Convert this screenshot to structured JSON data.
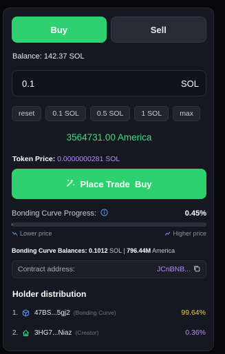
{
  "tabs": {
    "buy_label": "Buy",
    "sell_label": "Sell"
  },
  "balance": {
    "text": "Balance: 142.37 SOL"
  },
  "amount": {
    "value": "0.1",
    "unit": "SOL"
  },
  "presets": [
    "reset",
    "0.1 SOL",
    "0.5 SOL",
    "1 SOL",
    "max"
  ],
  "estimate": {
    "text": "3564731.00 America"
  },
  "token_price": {
    "label": "Token Price:",
    "value": "0.0000000281 SOL"
  },
  "cta": {
    "label": "Place Trade  Buy",
    "icon": "sparkle-icon"
  },
  "bonding": {
    "label": "Bonding Curve Progress:",
    "percent_text": "0.45%",
    "progress": 0.0045,
    "lower_label": "Lower price",
    "higher_label": "Higher price"
  },
  "balances": {
    "label": "Bonding Curve Balances:",
    "sol_value": "0.1012",
    "sol_text": "SOL |",
    "token_value": "796.44M",
    "token_text": "America"
  },
  "contract": {
    "label": "Contract address:",
    "value": "JCnBNB..."
  },
  "holders": {
    "title": "Holder distribution",
    "items": [
      {
        "rank": "1.",
        "address": "47BS...5gj2",
        "tag": "(Bonding Curve)",
        "percent": "99.64%",
        "icon": "cube-icon"
      },
      {
        "rank": "2.",
        "address": "3HG7...Niaz",
        "tag": "(Creator)",
        "percent": "0.36%",
        "icon": "home-icon"
      }
    ]
  },
  "colors": {
    "accent": "#2fd06f",
    "purple": "#b68cff",
    "gold": "#f2c94c",
    "panel": "#161821"
  }
}
